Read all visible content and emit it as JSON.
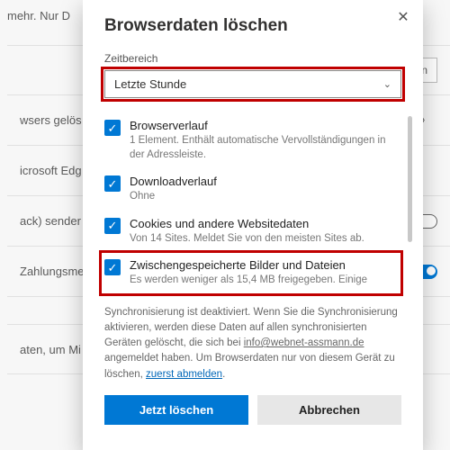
{
  "bg": {
    "line1": "mehr. Nur D",
    "choose": "hlen",
    "row2": "wsers gelös",
    "row3": "icrosoft Edg",
    "row4": "ack) sender",
    "row5": "Zahlungsme",
    "row6": "aten, um Mi"
  },
  "dialog": {
    "title": "Browserdaten löschen",
    "range_label": "Zeitbereich",
    "range_value": "Letzte Stunde",
    "items": [
      {
        "title": "Browserverlauf",
        "desc": "1 Element. Enthält automatische Vervollständigungen in der Adressleiste."
      },
      {
        "title": "Downloadverlauf",
        "desc": "Ohne"
      },
      {
        "title": "Cookies und andere Websitedaten",
        "desc": "Von 14 Sites. Meldet Sie von den meisten Sites ab."
      },
      {
        "title": "Zwischengespeicherte Bilder und Dateien",
        "desc": "Es werden weniger als 15,4 MB freigegeben. Einige"
      }
    ],
    "sync_pre": "Synchronisierung ist deaktiviert. Wenn Sie die Synchronisierung aktivieren, werden diese Daten auf allen synchronisierten Geräten gelöscht, die sich bei ",
    "sync_email": "info@webnet-assmann.de",
    "sync_mid": " angemeldet haben. Um Browserdaten nur von diesem Gerät zu löschen, ",
    "sync_link": "zuerst abmelden",
    "sync_end": ".",
    "clear": "Jetzt löschen",
    "cancel": "Abbrechen"
  }
}
